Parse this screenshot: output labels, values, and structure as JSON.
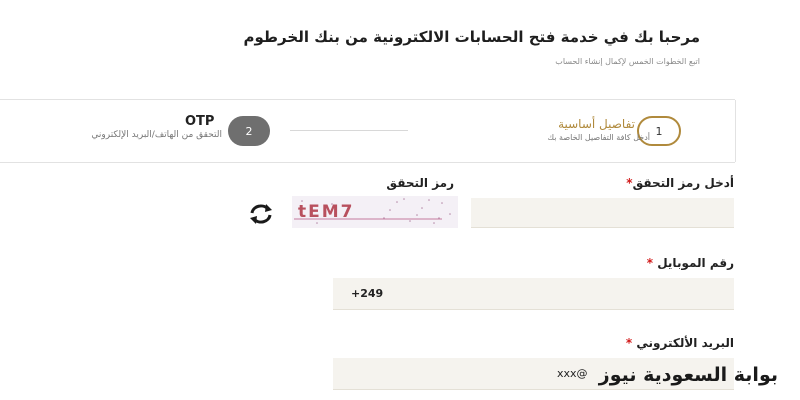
{
  "header": {
    "title": "مرحبا بك في خدمة فتح الحسابات الالكترونية من بنك الخرطوم",
    "subtitle": "اتبع الخطوات الخمس لإكمال إنشاء الحساب"
  },
  "steps": [
    {
      "number": "1",
      "title": "تفاصيل أساسية",
      "description": "أدخل كافة التفاصيل الخاصة بك",
      "state": "active"
    },
    {
      "number": "2",
      "title": "OTP",
      "description": "التحقق من الهاتف/البريد الإلكتروني",
      "state": "pending"
    }
  ],
  "form": {
    "captcha_field": {
      "label": "أدخل رمز التحقق",
      "required_mark": "*",
      "value": ""
    },
    "captcha_image": {
      "label": "رمز التحقق",
      "code": "tEM7"
    },
    "mobile_field": {
      "label": "رقم الموبايل",
      "required_mark": "*",
      "value": "+249"
    },
    "email_field": {
      "label": "البريد الألكتروني",
      "required_mark": "*",
      "value": "xxx@"
    }
  },
  "watermark": "بوابة السعودية نيوز",
  "colors": {
    "accent": "#b08a3c",
    "required": "#d21a1a",
    "input_bg": "#f5f3ee",
    "step_inactive": "#6f6f6f"
  },
  "icons": {
    "refresh": "refresh-icon"
  }
}
